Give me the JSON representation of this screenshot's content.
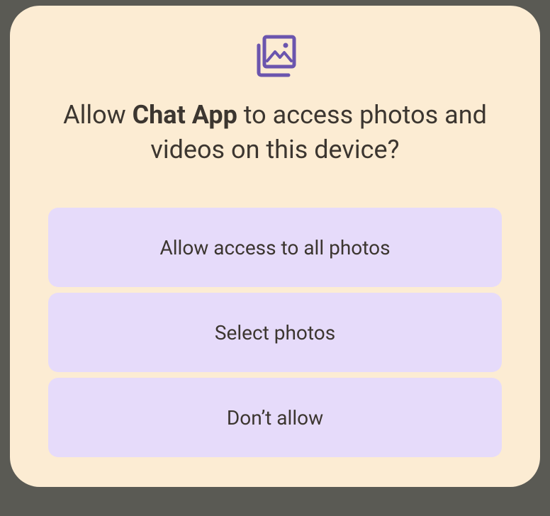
{
  "dialog": {
    "icon_name": "photo-library-icon",
    "icon_color": "#6b55ae",
    "title_prefix": "Allow ",
    "app_name": "Chat App",
    "title_suffix": " to access photos and videos on this device?",
    "options": [
      {
        "label": "Allow access to all photos"
      },
      {
        "label": "Select photos"
      },
      {
        "label": "Don’t allow"
      }
    ]
  }
}
